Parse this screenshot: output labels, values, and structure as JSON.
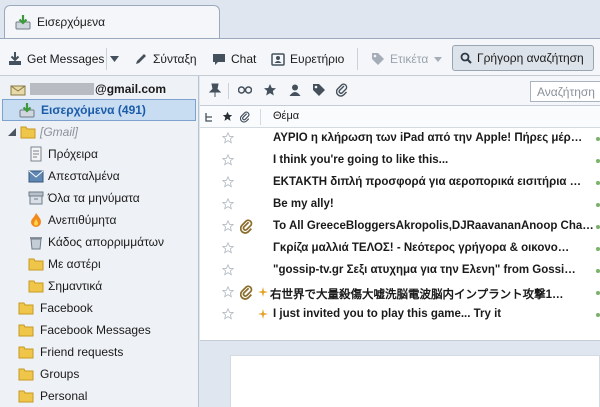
{
  "tab": {
    "title": "Εισερχόμενα",
    "icon": "inbox-icon"
  },
  "toolbar": {
    "get_messages": "Get Messages",
    "compose": "Σύνταξη",
    "chat": "Chat",
    "address_book": "Ευρετήριο",
    "tag": "Ετικέτα",
    "quick_filter": "Γρήγορη αναζήτηση"
  },
  "folders": {
    "account": "@gmail.com",
    "inbox": "Εισερχόμενα (491)",
    "gmail": "[Gmail]",
    "drafts": "Πρόχειρα",
    "sent": "Απεσταλμένα",
    "all_mail": "Όλα τα μηνύματα",
    "reminders": "Ανεπιθύμητα",
    "trash": "Κάδος απορριμμάτων",
    "starred": "Με αστέρι",
    "important": "Σημαντικά",
    "facebook": "Facebook",
    "facebook_messages": "Facebook Messages",
    "friend_requests": "Friend requests",
    "groups": "Groups",
    "personal": "Personal"
  },
  "list": {
    "search_placeholder": "Αναζήτηση",
    "subject_header": "Θέμα",
    "messages": [
      {
        "subject": "ΑΥΡΙΟ η κλήρωση των iPad από την Apple! Πήρες μέρ…",
        "starred": false,
        "attachment": false
      },
      {
        "subject": "I think you're going to like this...",
        "starred": false,
        "attachment": false
      },
      {
        "subject": "ΕΚΤΑΚΤΗ διπλή προσφορά για αεροπορικά εισιτήρια …",
        "starred": false,
        "attachment": false
      },
      {
        "subject": "Be my ally!",
        "starred": false,
        "attachment": false
      },
      {
        "subject": "To All GreeceBloggersAkropolis,DJRaavananAnoop Cha…",
        "starred": false,
        "attachment": true
      },
      {
        "subject": "Γκρίζα μαλλιά ΤΕΛΟΣ! - Νεότερος γρήγορα & οικονο…",
        "starred": false,
        "attachment": false
      },
      {
        "subject": "\"gossip-tv.gr Σεξι ατυχημα για την Ελενη\" from Gossi…",
        "starred": false,
        "attachment": false
      },
      {
        "subject": "右世界で大量殺傷大嘘洗脳電波脳内インプラント攻撃1…",
        "starred": false,
        "attachment": true
      },
      {
        "subject": "I just invited you to play this game... Try it",
        "starred": false,
        "attachment": false
      }
    ]
  },
  "colors": {
    "accent": "#1b5ca8",
    "selection": "#c8dcf2",
    "folder": "#f0c64a"
  }
}
